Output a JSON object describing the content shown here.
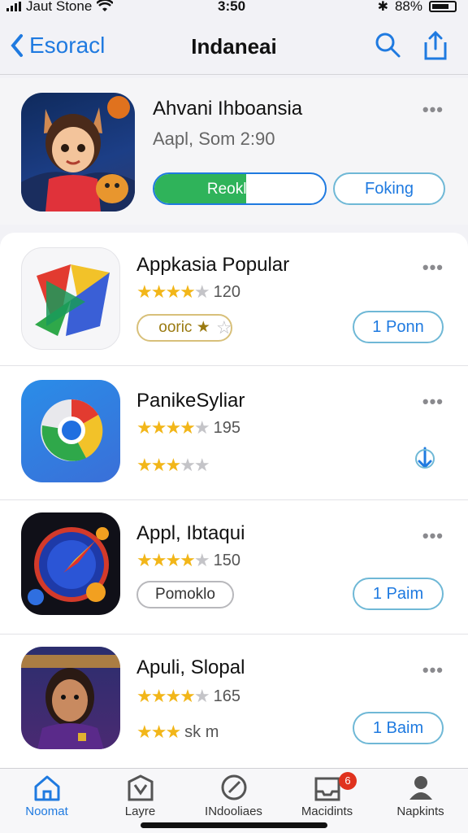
{
  "status_bar": {
    "carrier": "Jaut Stone",
    "time": "3:50",
    "battery": "88%"
  },
  "nav": {
    "back_label": "Esoracl",
    "title": "Indaneai"
  },
  "featured": {
    "name": "Ahvani Ihboansia",
    "subtitle": "Aapl, Som 2:90",
    "progress_label": "Reoklaon",
    "progress": 0.54,
    "secondary_label": "Foking",
    "more": "•••"
  },
  "apps": [
    {
      "name": "Appkasia Popular",
      "rating_value": "120",
      "stars": 4,
      "tag": "ooric ★",
      "action": "1 Ponn",
      "more": "•••"
    },
    {
      "name": "PanikeSyliar",
      "rating_value": "195",
      "stars": 4,
      "secondary_stars": 3,
      "action_icon": "download-icon",
      "more": "•••"
    },
    {
      "name": "Appl, Ibtaqui",
      "rating_value": "150",
      "stars": 4,
      "tag": "Pomoklo",
      "action": "1 Paim",
      "more": "•••"
    },
    {
      "name": "Apuli, Slopal",
      "rating_value": "165",
      "stars": 4,
      "secondary_stars": 3,
      "secondary_text": "sk m",
      "action": "1 Baim",
      "more": "•••"
    }
  ],
  "tabs": [
    {
      "label": "Noomat",
      "icon": "home-icon",
      "active": true
    },
    {
      "label": "Layre",
      "icon": "store-icon"
    },
    {
      "label": "INdooliaes",
      "icon": "compass-icon"
    },
    {
      "label": "Macidints",
      "icon": "inbox-icon",
      "badge": "6"
    },
    {
      "label": "Napkints",
      "icon": "person-icon"
    }
  ],
  "colors": {
    "accent": "#1f7ae0",
    "progress": "#2fb35a",
    "star": "#f2b619",
    "badge": "#e0321e"
  }
}
